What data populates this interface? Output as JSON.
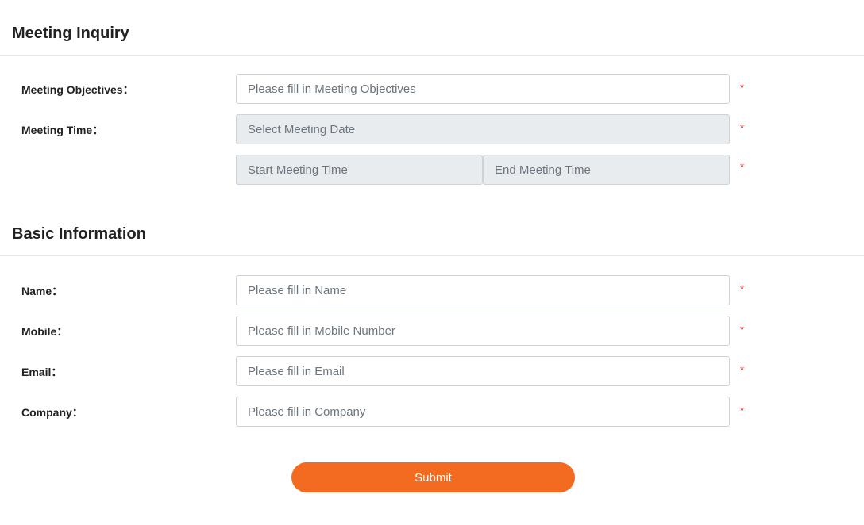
{
  "meeting_section": {
    "title": "Meeting Inquiry",
    "objectives_label": "Meeting Objectives：",
    "objectives_placeholder": "Please fill in Meeting Objectives",
    "time_label": "Meeting Time：",
    "date_placeholder": "Select Meeting Date",
    "start_time_placeholder": "Start Meeting Time",
    "end_time_placeholder": "End Meeting Time"
  },
  "basic_section": {
    "title": "Basic Information",
    "name_label": "Name：",
    "name_placeholder": "Please fill in Name",
    "mobile_label": "Mobile：",
    "mobile_placeholder": "Please fill in Mobile Number",
    "email_label": "Email：",
    "email_placeholder": "Please fill in Email",
    "company_label": "Company：",
    "company_placeholder": "Please fill in Company"
  },
  "required_marker": "*",
  "submit_label": "Submit",
  "colors": {
    "accent": "#f26b21",
    "required": "#e02b2b",
    "readonly_bg": "#e9ecef"
  }
}
